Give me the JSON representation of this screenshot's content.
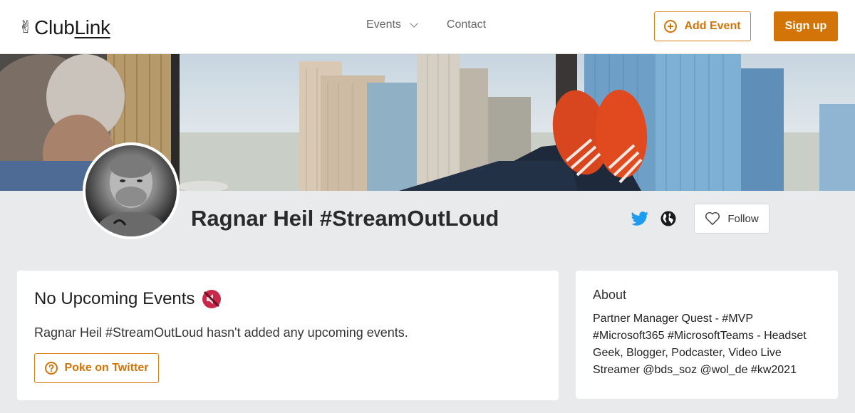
{
  "header": {
    "logo": {
      "glyph": "✌",
      "text_main": "Club",
      "text_underlined": "Link"
    },
    "nav": [
      {
        "label": "Events",
        "has_dropdown": true
      },
      {
        "label": "Contact",
        "has_dropdown": false
      }
    ],
    "add_event_label": "Add Event",
    "sign_up_label": "Sign up"
  },
  "profile": {
    "name": "Ragnar Heil #StreamOutLoud",
    "follow_label": "Follow",
    "links": [
      "twitter-icon",
      "globe-icon"
    ]
  },
  "events_card": {
    "title": "No Upcoming Events",
    "title_icon": "muted-speaker-icon",
    "message": "Ragnar Heil #StreamOutLoud hasn't added any upcoming events.",
    "poke_label": "Poke on Twitter"
  },
  "about_card": {
    "title": "About",
    "text": "Partner Manager Quest - #MVP #Microsoft365 #MicrosoftTeams - Headset Geek, Blogger, Podcaster, Video Live Streamer @bds_soz @wol_de #kw2021"
  },
  "colors": {
    "accent": "#d27408",
    "page_background": "#e9eaec",
    "twitter_blue": "#1d9bf0"
  }
}
